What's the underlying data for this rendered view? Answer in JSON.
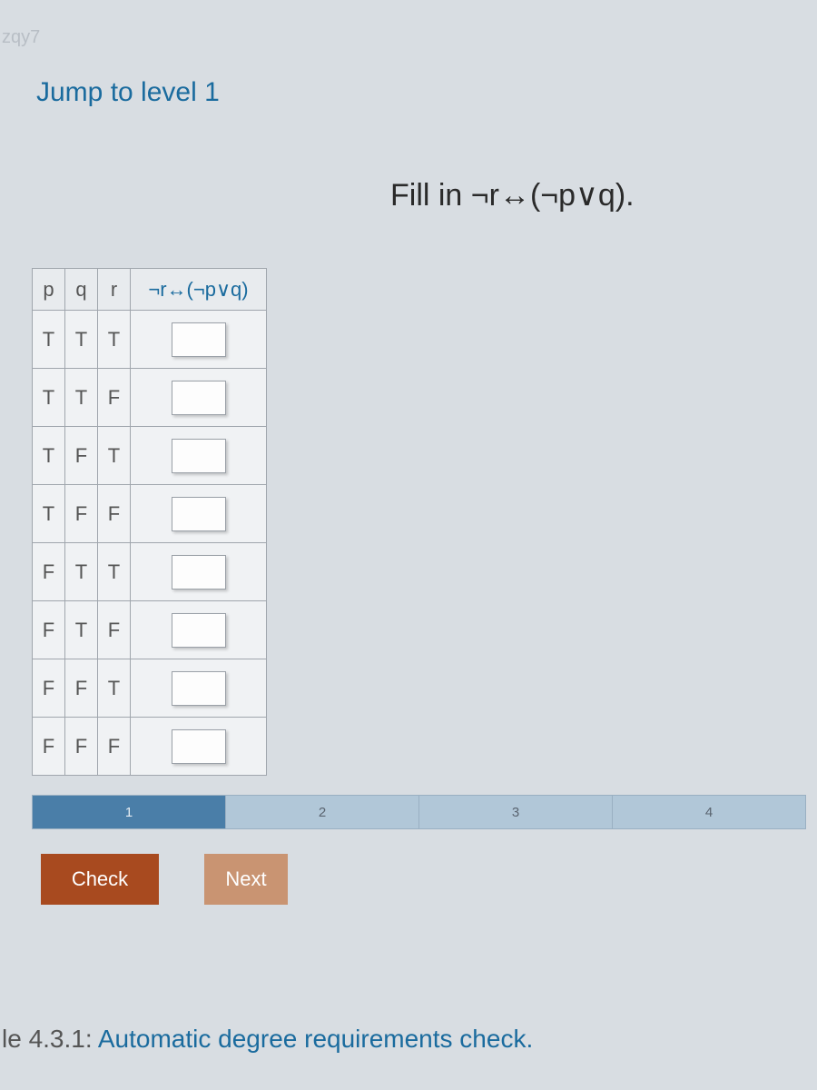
{
  "watermark": "zqy7",
  "jump_link": "Jump to level 1",
  "instruction": "Fill in ¬r↔(¬p∨q).",
  "table": {
    "headers": {
      "p": "p",
      "q": "q",
      "r": "r",
      "expr": "¬r↔(¬p∨q)"
    },
    "rows": [
      {
        "p": "T",
        "q": "T",
        "r": "T"
      },
      {
        "p": "T",
        "q": "T",
        "r": "F"
      },
      {
        "p": "T",
        "q": "F",
        "r": "T"
      },
      {
        "p": "T",
        "q": "F",
        "r": "F"
      },
      {
        "p": "F",
        "q": "T",
        "r": "T"
      },
      {
        "p": "F",
        "q": "T",
        "r": "F"
      },
      {
        "p": "F",
        "q": "F",
        "r": "T"
      },
      {
        "p": "F",
        "q": "F",
        "r": "F"
      }
    ]
  },
  "progress": {
    "steps": [
      "1",
      "2",
      "3",
      "4"
    ],
    "active": 0
  },
  "buttons": {
    "check": "Check",
    "next": "Next"
  },
  "footer": {
    "prefix": "le 4.3.1: ",
    "rest": "Automatic degree requirements check."
  }
}
